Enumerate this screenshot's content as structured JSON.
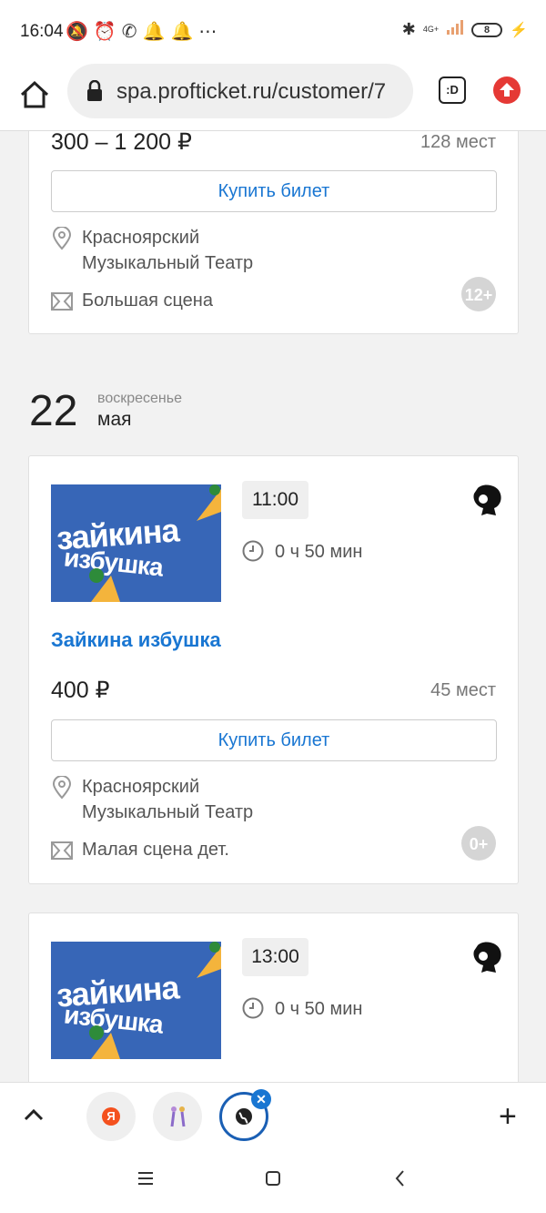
{
  "status": {
    "time": "16:04",
    "net": "4G+",
    "battery": "8"
  },
  "browser": {
    "url": "spa.profticket.ru/customer/7",
    "tabs_label": ":D"
  },
  "card_top": {
    "price": "300 – 1 200 ₽",
    "seats": "128 мест",
    "buy_label": "Купить билет",
    "venue_line1": "Красноярский",
    "venue_line2": "Музыкальный Театр",
    "stage": "Большая сцена",
    "age": "12+"
  },
  "date": {
    "day": "22",
    "weekday": "воскресенье",
    "month": "мая"
  },
  "events": [
    {
      "poster_line1": "зайкина",
      "poster_line2": "избушка",
      "time": "11:00",
      "duration": "0 ч 50 мин",
      "title": "Зайкина избушка",
      "price": "400 ₽",
      "seats": "45 мест",
      "buy_label": "Купить билет",
      "venue_line1": "Красноярский",
      "venue_line2": "Музыкальный Театр",
      "stage": "Малая сцена дет.",
      "age": "0+"
    },
    {
      "poster_line1": "зайкина",
      "poster_line2": "избушка",
      "time": "13:00",
      "duration": "0 ч 50 мин"
    }
  ],
  "bottom": {
    "tab1_label": "Я"
  },
  "colors": {
    "link": "#1976d2",
    "accent_red": "#e53935",
    "poster_blue": "#3766b7"
  }
}
